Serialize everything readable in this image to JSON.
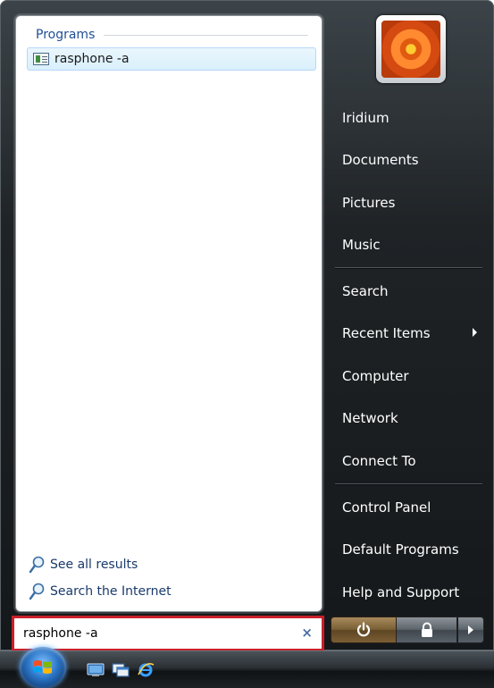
{
  "left_pane": {
    "programs_header": "Programs",
    "results": [
      {
        "label": "rasphone -a",
        "icon": "program-window-icon"
      }
    ],
    "see_all_results": "See all results",
    "search_the_internet": "Search the Internet"
  },
  "search": {
    "value": "rasphone -a",
    "clear_glyph": "×",
    "highlight_color": "#c8202a"
  },
  "right_pane": {
    "items": [
      {
        "label": "Iridium"
      },
      {
        "label": "Documents"
      },
      {
        "label": "Pictures"
      },
      {
        "label": "Music"
      },
      {
        "label": "Search"
      },
      {
        "label": "Recent Items",
        "has_submenu": true
      },
      {
        "label": "Computer"
      },
      {
        "label": "Network"
      },
      {
        "label": "Connect To"
      },
      {
        "label": "Control Panel"
      },
      {
        "label": "Default Programs"
      },
      {
        "label": "Help and Support"
      }
    ]
  },
  "user_picture": {
    "icon": "flower-user-picture"
  },
  "power_buttons": {
    "power_icon": "power-icon",
    "lock_icon": "lock-icon",
    "options_icon": "arrow-right-icon"
  },
  "taskbar": {
    "start_icon": "windows-orb-icon",
    "quick_launch": [
      "show-desktop-icon",
      "switch-windows-icon",
      "internet-explorer-icon"
    ]
  },
  "colors": {
    "accent_header": "#1f4f95",
    "selection": "#d9f0fc"
  }
}
